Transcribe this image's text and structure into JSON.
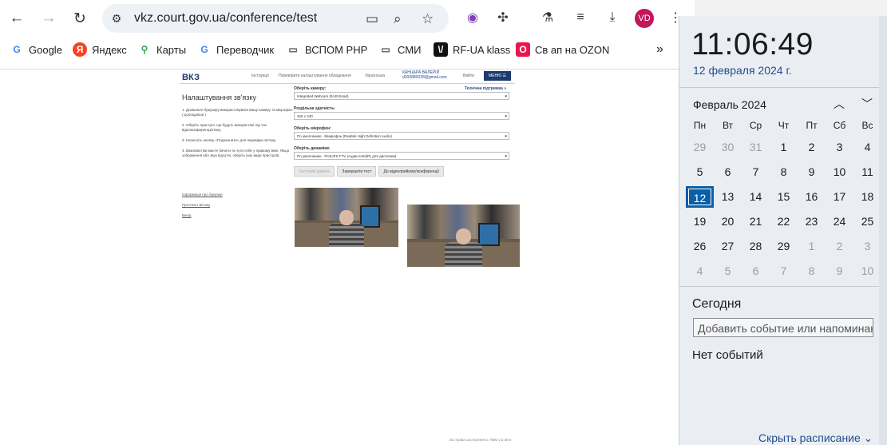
{
  "browser": {
    "url": "vkz.court.gov.ua/conference/test",
    "avatar": "VD",
    "bookmarks": [
      {
        "label": "Google",
        "icon": "G",
        "color": "#4285f4"
      },
      {
        "label": "Яндекс",
        "icon": "Я",
        "color": "#fc3f1d"
      },
      {
        "label": "Карты",
        "icon": "maps-pin-icon",
        "color": "#34a853"
      },
      {
        "label": "Переводчик",
        "icon": "G",
        "color": "#4285f4"
      },
      {
        "label": "ВСПОМ PHP",
        "icon": "folder-icon",
        "color": "#555"
      },
      {
        "label": "СМИ",
        "icon": "folder-icon",
        "color": "#555"
      },
      {
        "label": "RF-UA klass",
        "icon": "\\/",
        "color": "#111"
      },
      {
        "label": "Св ап на OZON",
        "icon": "O",
        "color": "#e8174b"
      }
    ]
  },
  "site": {
    "logo": "ВКЗ",
    "links": [
      "Інструкції",
      "Перевірити налаштування обладнання",
      "Українська"
    ],
    "user_name": "КАНЦАРА ВАЛЕРІЙ",
    "user_email": "d200880028@gmail.com",
    "logout": "Вийти",
    "menu": "МЕНЮ",
    "title": "Налаштування зв'язку",
    "steps": [
      "1. Дозвольте браузеру використовувати вашу камеру та мікрофон. ( докладніше )",
      "2. Оберіть пристрої, що будуть використані під час відеоконференцзв'язку.",
      "3. Натисніть кнопку «Подзвонити» для перевірки зв'язку.",
      "4. Важливо! Ви маєте бачити та чути себе у правому вікні. Якщо зображення або звук відсутні, оберіть інші види пристроїв."
    ],
    "side_links": [
      "Інформація про браузер",
      "Протокол зв'язку",
      "Вихід"
    ],
    "support": "Технічна підтримка »",
    "fields": [
      {
        "label": "Оберіть камеру:",
        "value": "Integrated Webcam (0c45:64ad)"
      },
      {
        "label": "Роздільна здатність:",
        "value": "426 x 240"
      },
      {
        "label": "Оберіть мікрофон:",
        "value": "По умолчанию - Микрофон (Realtek High Definition Audio)"
      },
      {
        "label": "Оберіть динаміки:",
        "value": "По умолчанию - PHILIPS FTV (Аудио Intel(R) для дисплеев)"
      }
    ],
    "buttons": [
      "Тестовий дзвінок",
      "Завершити тест",
      "До відеоприйому/конференції"
    ],
    "footer": "Всі права застережено. ПВМ v.2.39.0"
  },
  "calendar": {
    "time": "11:06:49",
    "date": "12 февраля 2024 г.",
    "month": "Февраль 2024",
    "weekdays": [
      "Пн",
      "Вт",
      "Ср",
      "Чт",
      "Пт",
      "Сб",
      "Вс"
    ],
    "weeks": [
      [
        "29",
        "30",
        "31",
        "1",
        "2",
        "3",
        "4"
      ],
      [
        "5",
        "6",
        "7",
        "8",
        "9",
        "10",
        "11"
      ],
      [
        "12",
        "13",
        "14",
        "15",
        "16",
        "17",
        "18"
      ],
      [
        "19",
        "20",
        "21",
        "22",
        "23",
        "24",
        "25"
      ],
      [
        "26",
        "27",
        "28",
        "29",
        "1",
        "2",
        "3"
      ],
      [
        "4",
        "5",
        "6",
        "7",
        "8",
        "9",
        "10"
      ]
    ],
    "today": "12",
    "today_label": "Сегодня",
    "event_placeholder": "Добавить событие или напоминание",
    "no_events": "Нет событий",
    "schedule": "Скрыть расписание"
  }
}
